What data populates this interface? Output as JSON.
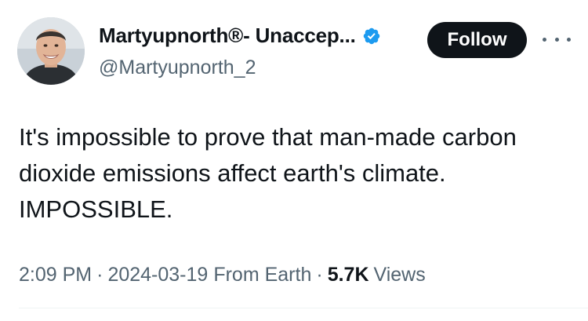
{
  "author": {
    "display_name": "Martyupnorth®- Unaccep...",
    "handle": "@Martyupnorth_2",
    "verified_icon": "verified-badge-icon",
    "avatar_icon": "profile-photo"
  },
  "actions": {
    "follow_label": "Follow",
    "more_icon": "more-options-icon"
  },
  "tweet": {
    "lines": [
      "It's impossible to prove that man-made carbon",
      "dioxide emissions affect earth's climate.",
      "IMPOSSIBLE."
    ]
  },
  "meta": {
    "time": "2:09 PM",
    "separator": "·",
    "date": "2024-03-19",
    "location": "From Earth",
    "views_count": "5.7K",
    "views_label": "Views"
  },
  "colors": {
    "text": "#0f1419",
    "secondary": "#536471",
    "verified": "#1d9bf0",
    "button_bg": "#0f1419",
    "button_text": "#ffffff"
  }
}
